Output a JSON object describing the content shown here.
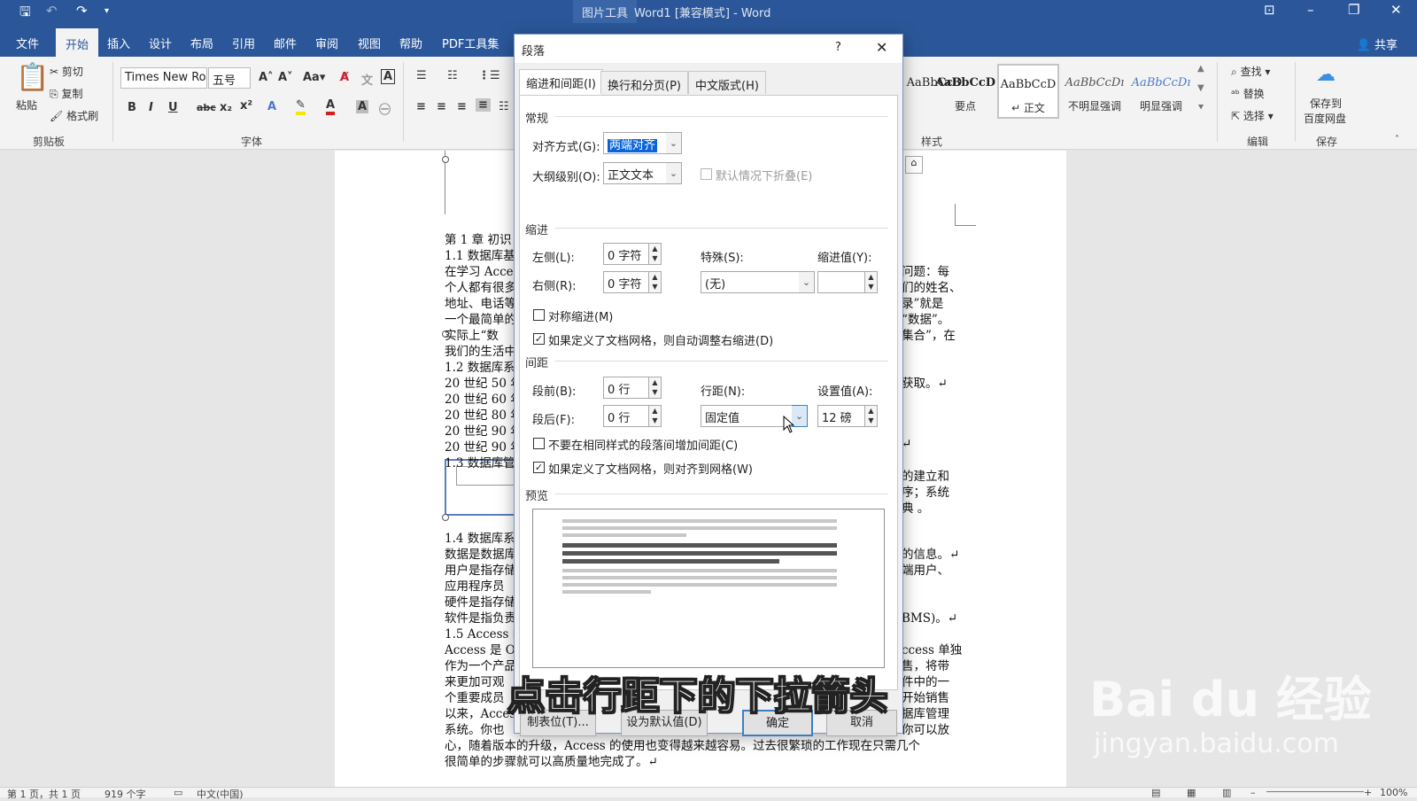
{
  "titlebar": {
    "picture_tools": "图片工具",
    "title": "Word1 [兼容模式]  -  Word"
  },
  "ribbon_tabs": [
    "文件",
    "开始",
    "插入",
    "设计",
    "布局",
    "引用",
    "邮件",
    "审阅",
    "视图",
    "帮助",
    "PDF工具集"
  ],
  "share_label": "共享",
  "ribbon": {
    "paste": "粘贴",
    "cut": "剪切",
    "copy": "复制",
    "format_painter": "格式刷",
    "clipboard": "剪贴板",
    "font_name": "Times New Ro",
    "font_size": "五号",
    "font_group": "字体",
    "styles": [
      {
        "sample": "AaBbCcD",
        "name": ""
      },
      {
        "sample": "AaBbCcD",
        "name": "要点"
      },
      {
        "sample": "AaBbCcD",
        "name": "↵ 正文"
      },
      {
        "sample": "AaBbCcDı",
        "name": "不明显强调"
      },
      {
        "sample": "AaBbCcDı",
        "name": "明显强调"
      }
    ],
    "styles_group": "样式",
    "find": "查找",
    "replace": "替换",
    "select": "选择",
    "edit_group": "编辑",
    "save_baidu_1": "保存到",
    "save_baidu_2": "百度网盘",
    "save_group": "保存"
  },
  "document": {
    "left_lines": [
      "第 1 章  初识",
      "1.1  数据库基",
      "在学习 Acce",
      "个人都有很多",
      "地址、电话等",
      "一个最简单的",
      "实际上“数",
      "我们的生活中",
      "1.2  数据库系",
      "20 世纪 50 年",
      "20 世纪 60 年",
      "20 世纪 80 年",
      "20 世纪 90 年",
      "20 世纪 90 年",
      "1.3  数据库管"
    ],
    "right_lines": [
      "问题：每",
      "们的姓名、",
      "录”就是",
      "“数据”。",
      "集合”，在",
      "",
      "",
      "获取。↵",
      "",
      "",
      "",
      "",
      "↵",
      "",
      "",
      "的建立和",
      "序；系统",
      "典      。"
    ],
    "left_lines_2": [
      "1.4  数据库系",
      "数据是数据库",
      "用户是指存储",
      "应用程序员",
      "硬件是指存储",
      "软件是指负责",
      "1.5 Access 的",
      "Access 是 Of",
      "作为一个产品",
      "来更加可观",
      "个重要成员",
      "以来，Acces",
      "系统。你也"
    ],
    "right_lines_2": [
      "的信息。↵",
      "端用户、",
      "",
      "",
      "BMS)。↵",
      "",
      "ccess 单独",
      "售，将带",
      "件中的一",
      "开始销售",
      "据库管理",
      "你可以放"
    ],
    "bottom_line_1": "心，随着版本的升级，Access 的使用也变得越来越容易。过去很繁琐的工作现在只需几个",
    "bottom_line_2": "很简单的步骤就可以高质量地完成了。↵"
  },
  "status": {
    "page": "第 1 页，共 1 页",
    "words": "919 个字",
    "lang": "中文(中国)",
    "zoom": "100%"
  },
  "dialog": {
    "title": "段落",
    "help": "?",
    "tabs": [
      "缩进和间距(I)",
      "换行和分页(P)",
      "中文版式(H)"
    ],
    "general": {
      "section": "常规",
      "alignment_label": "对齐方式(G):",
      "alignment_value": "两端对齐",
      "outline_label": "大纲级别(O):",
      "outline_value": "正文文本",
      "collapse_label": "默认情况下折叠(E)"
    },
    "indent": {
      "section": "缩进",
      "left_label": "左侧(L):",
      "left_value": "0 字符",
      "right_label": "右侧(R):",
      "right_value": "0 字符",
      "special_label": "特殊(S):",
      "special_value": "(无)",
      "indent_by_label": "缩进值(Y):",
      "indent_by_value": "",
      "mirror_label": "对称缩进(M)",
      "auto_adjust_label": "如果定义了文档网格，则自动调整右缩进(D)"
    },
    "spacing": {
      "section": "间距",
      "before_label": "段前(B):",
      "before_value": "0 行",
      "after_label": "段后(F):",
      "after_value": "0 行",
      "line_label": "行距(N):",
      "line_value": "固定值",
      "at_label": "设置值(A):",
      "at_value": "12 磅",
      "no_add_label": "不要在相同样式的段落间增加间距(C)",
      "snap_grid_label": "如果定义了文档网格，则对齐到网格(W)"
    },
    "preview_section": "预览",
    "buttons": {
      "tabs": "制表位(T)...",
      "default": "设为默认值(D)",
      "ok": "确定",
      "cancel": "取消"
    }
  },
  "caption": "点击行距下的下拉箭头",
  "watermark": {
    "brand": "Bai du 经验",
    "url": "jingyan.baidu.com"
  }
}
